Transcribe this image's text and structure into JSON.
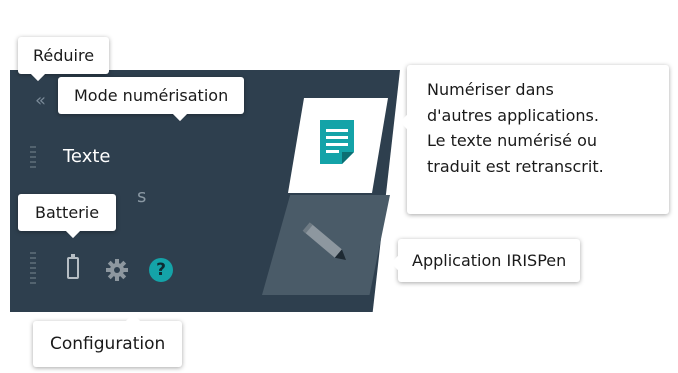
{
  "sidebar": {
    "collapse_glyph": "«",
    "mode_label": "Texte",
    "second_label_fragment": "s"
  },
  "tooltips": {
    "reduire": "Réduire",
    "mode": "Mode numérisation",
    "batterie": "Batterie",
    "configuration": "Configuration",
    "numeriser_lines": [
      "Numériser dans",
      "d'autres applications.",
      "Le texte numérisé ou",
      "traduit est retranscrit."
    ],
    "irispen": "Application IRISPen"
  },
  "icons": {
    "collapse": "double-chevron-left-icon",
    "battery": "battery-icon",
    "settings": "gear-icon",
    "help": "help-icon",
    "document": "document-icon",
    "pen": "pen-icon"
  },
  "help_glyph": "?",
  "colors": {
    "panel": "#2e3f4e",
    "accent": "#14a3a8",
    "inactive_card": "#4a5b68"
  }
}
